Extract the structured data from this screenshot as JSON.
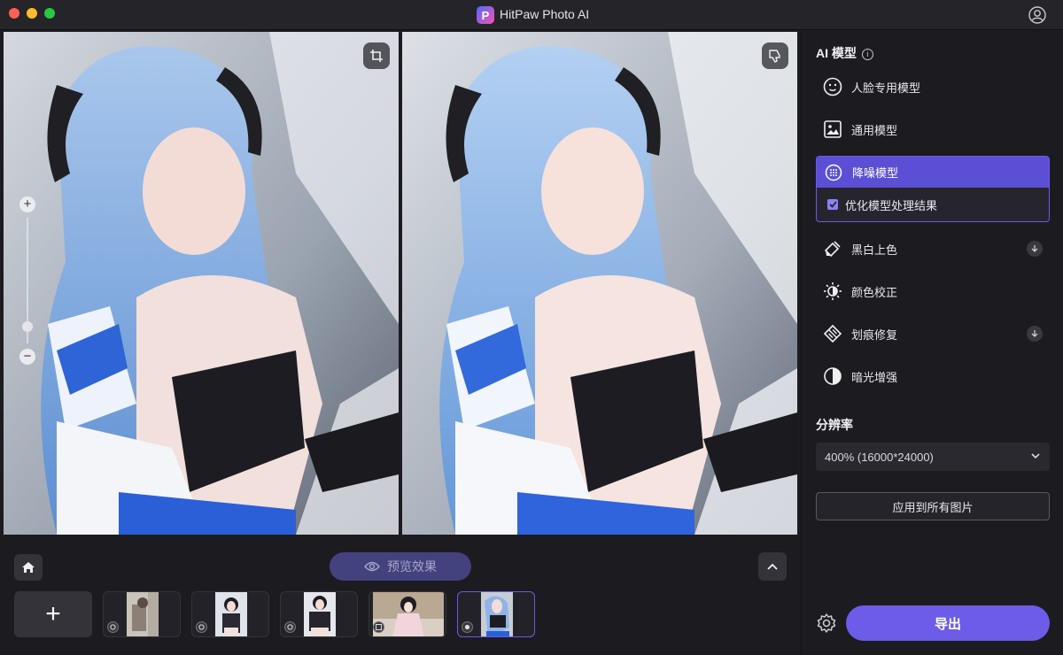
{
  "window": {
    "app_title": "HitPaw Photo AI",
    "logo_letter": "P"
  },
  "viewer": {
    "zoom_plus": "+",
    "zoom_minus": "−"
  },
  "bottom_bar": {
    "preview_label": "预览效果",
    "add_symbol": "+",
    "thumbnails": [
      {
        "badge_icon": "face-model-icon",
        "selected": false
      },
      {
        "badge_icon": "face-model-icon",
        "selected": false
      },
      {
        "badge_icon": "face-model-icon",
        "selected": false
      },
      {
        "badge_icon": "general-model-icon",
        "selected": false
      },
      {
        "badge_icon": "denoise-model-icon",
        "selected": true
      }
    ]
  },
  "sidebar": {
    "ai_model_title": "AI 模型",
    "info_symbol": "i",
    "models": [
      {
        "label": "人脸专用模型",
        "icon": "face-icon",
        "download": false
      },
      {
        "label": "通用模型",
        "icon": "image-icon",
        "download": false
      },
      {
        "label": "降噪模型",
        "icon": "denoise-icon",
        "download": false,
        "active": true
      },
      {
        "label": "黑白上色",
        "icon": "colorize-icon",
        "download": true
      },
      {
        "label": "颜色校正",
        "icon": "brightness-icon",
        "download": false
      },
      {
        "label": "划痕修复",
        "icon": "scratch-icon",
        "download": true
      },
      {
        "label": "暗光增强",
        "icon": "contrast-icon",
        "download": false
      }
    ],
    "optimize_option": {
      "label": "优化模型处理结果",
      "checked": true
    },
    "resolution_title": "分辨率",
    "resolution_value": "400% (16000*24000)",
    "apply_all_label": "应用到所有图片",
    "export_label": "导出"
  },
  "colors": {
    "accent": "#6c5ce7",
    "active_model_bg": "#5b4fd6",
    "panel_bg": "#1c1b20"
  }
}
